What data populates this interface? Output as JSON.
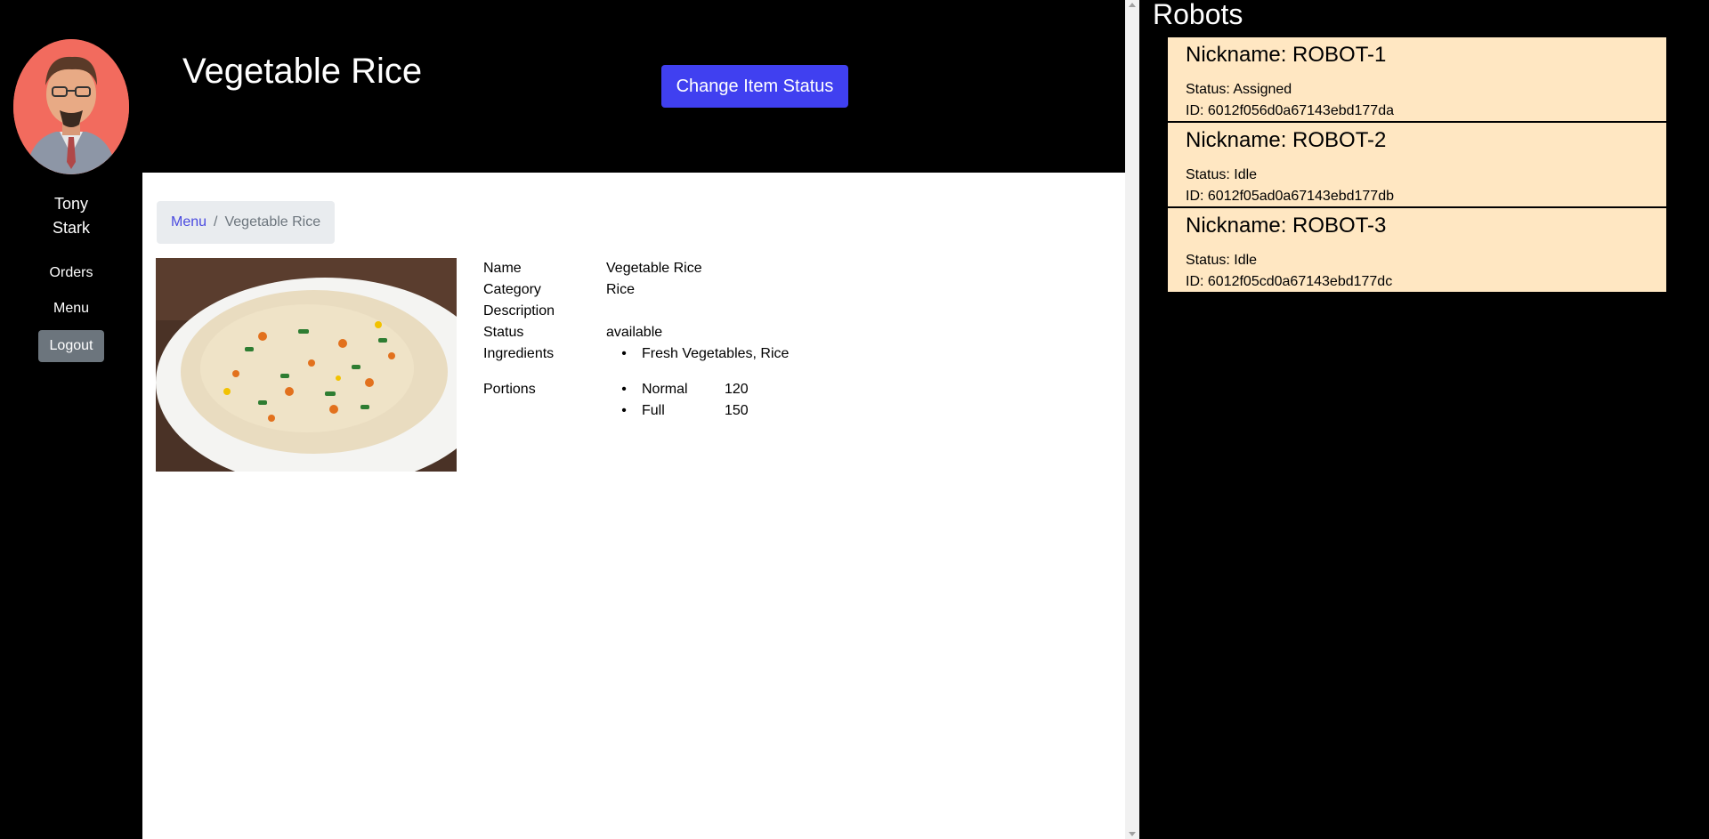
{
  "user": {
    "first_name": "Tony",
    "last_name": "Stark"
  },
  "nav": {
    "orders": "Orders",
    "menu": "Menu",
    "logout": "Logout"
  },
  "header": {
    "title": "Vegetable Rice",
    "change_status_label": "Change Item Status"
  },
  "breadcrumb": {
    "root": "Menu",
    "separator": "/",
    "current": "Vegetable Rice"
  },
  "item": {
    "fields": {
      "name": {
        "label": "Name",
        "value": "Vegetable Rice"
      },
      "category": {
        "label": "Category",
        "value": "Rice"
      },
      "description": {
        "label": "Description",
        "value": ""
      },
      "status": {
        "label": "Status",
        "value": "available"
      },
      "ingredients": {
        "label": "Ingredients",
        "value": "Fresh Vegetables, Rice"
      }
    },
    "portions": {
      "label": "Portions",
      "items": [
        {
          "name": "Normal",
          "price": "120"
        },
        {
          "name": "Full",
          "price": "150"
        }
      ]
    }
  },
  "robots": {
    "title": "Robots",
    "items": [
      {
        "nickname": "Nickname: ROBOT-1",
        "status": "Status: Assigned",
        "id": "ID: 6012f056d0a67143ebd177da"
      },
      {
        "nickname": "Nickname: ROBOT-2",
        "status": "Status: Idle",
        "id": "ID: 6012f05ad0a67143ebd177db"
      },
      {
        "nickname": "Nickname: ROBOT-3",
        "status": "Status: Idle",
        "id": "ID: 6012f05cd0a67143ebd177dc"
      }
    ]
  },
  "colors": {
    "background": "#000000",
    "primary_button": "#4040f0",
    "secondary_button": "#6c757d",
    "robot_card": "#ffe7c2",
    "avatar_bg": "#f26b5e"
  },
  "icons": {
    "avatar": "user-avatar-illustration",
    "food_photo": "vegetable-rice-photo"
  }
}
